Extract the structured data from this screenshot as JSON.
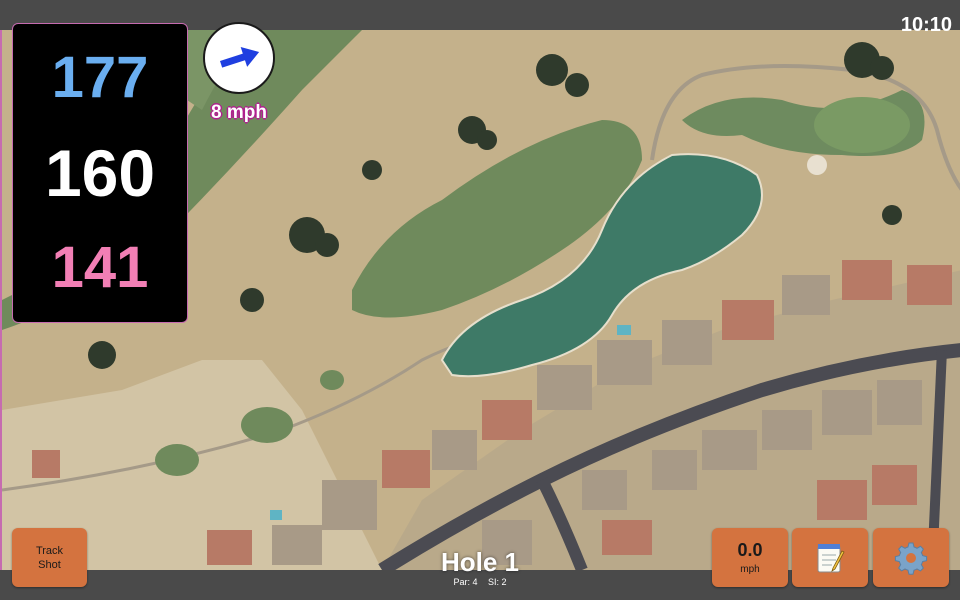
{
  "status": {
    "time": "10:10"
  },
  "distances": {
    "back": "177",
    "center": "160",
    "front": "141"
  },
  "wind": {
    "speed": "8 mph",
    "icon": "wind-arrow-icon"
  },
  "buttons": {
    "track_shot": {
      "line1": "Track",
      "line2": "Shot"
    },
    "speed": {
      "value": "0.0",
      "unit": "mph"
    },
    "notes_icon": "notepad-icon",
    "settings_icon": "gear-icon"
  },
  "hole": {
    "title": "Hole 1",
    "par": "Par: 4",
    "si": "SI: 2"
  },
  "colors": {
    "back": "#6aaef0",
    "center": "#ffffff",
    "front": "#f27fb5",
    "button": "#d4733f",
    "accent": "#c66bb0"
  }
}
